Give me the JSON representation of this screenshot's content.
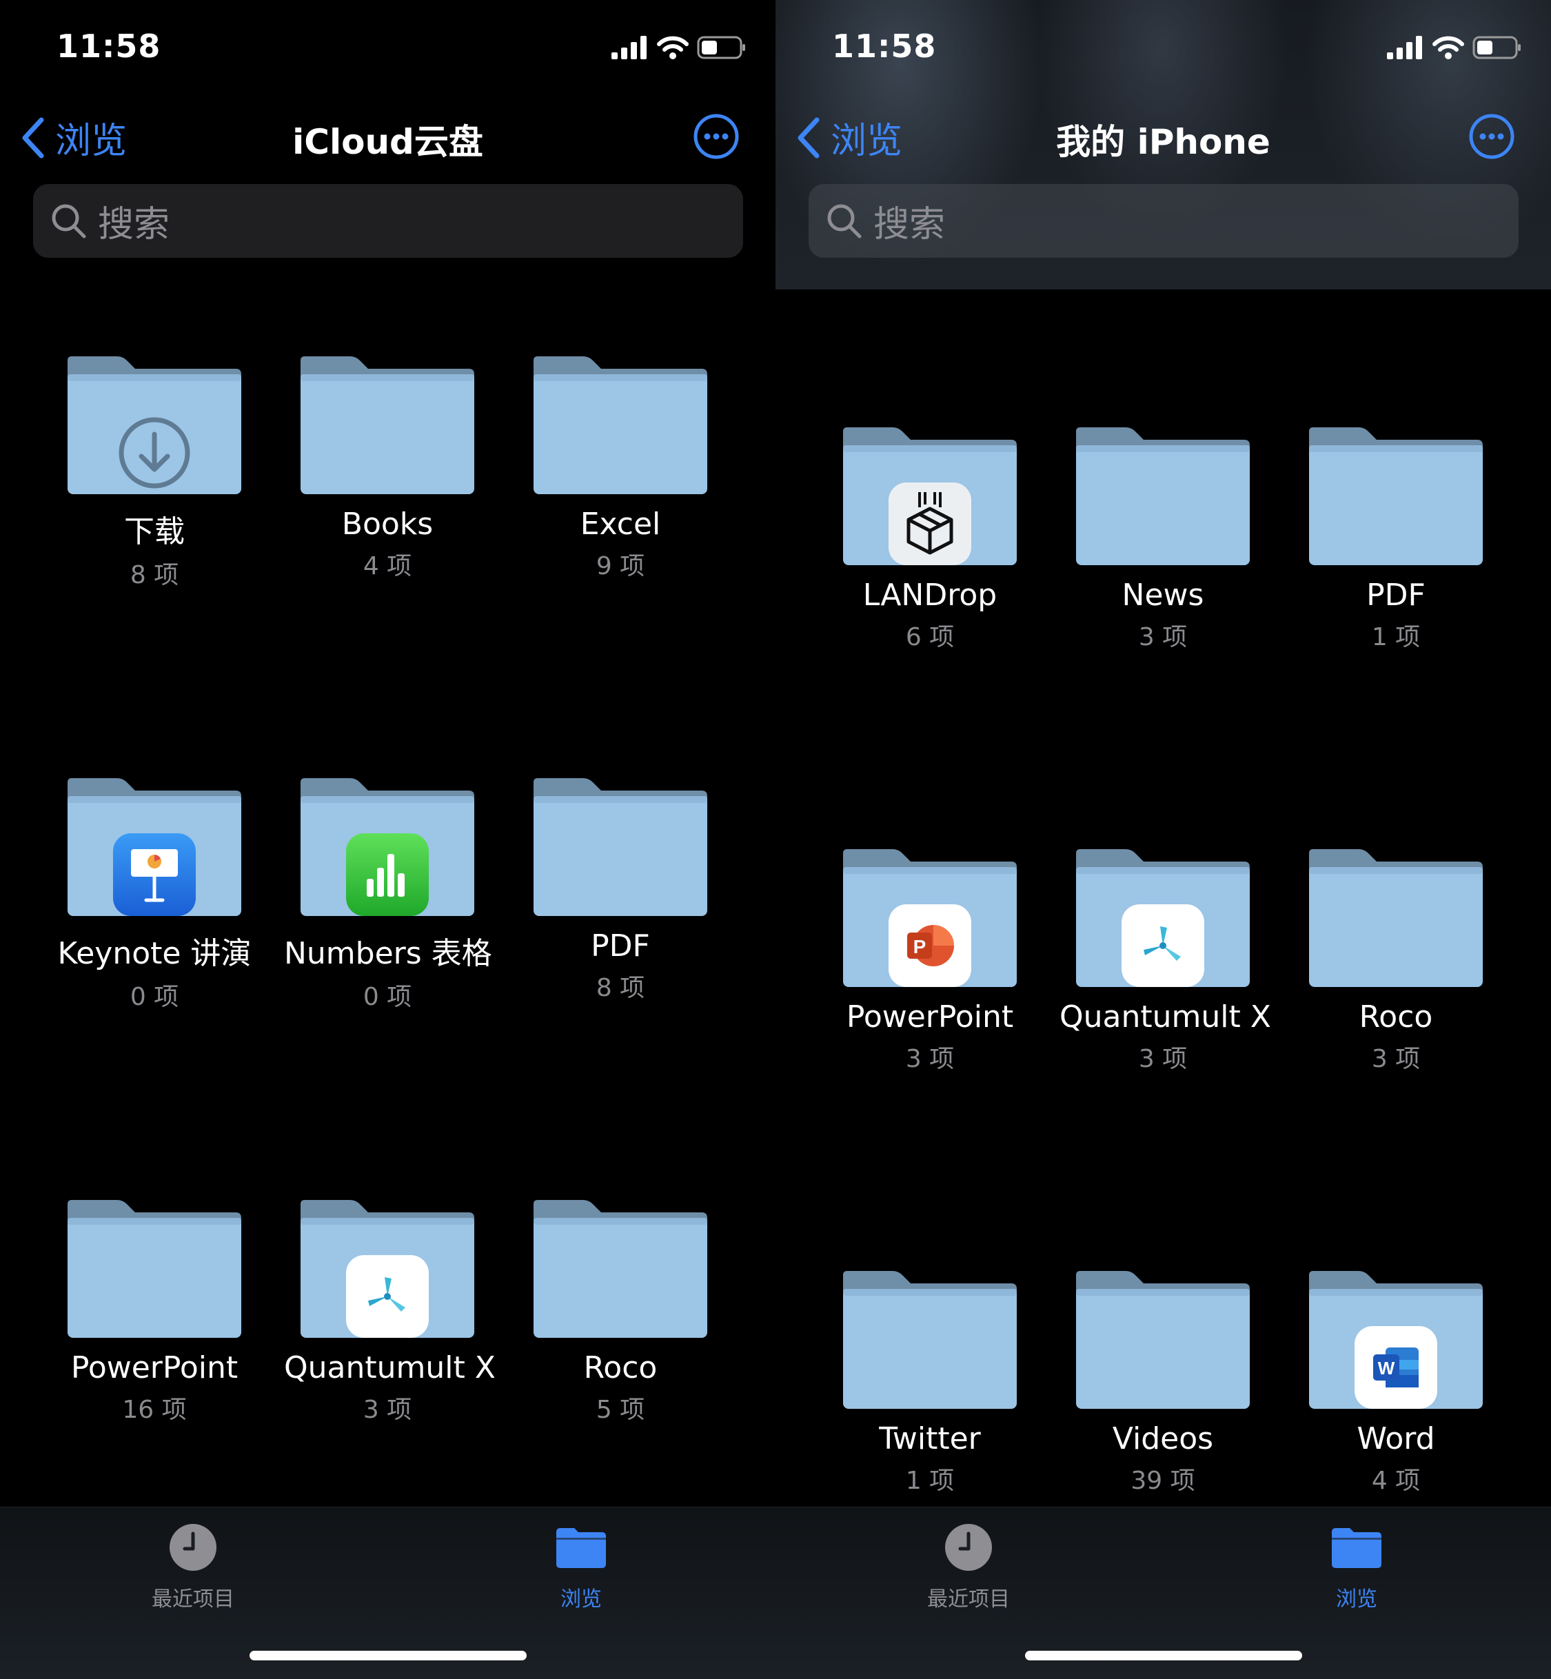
{
  "status_bar": {
    "time": "11:58"
  },
  "colors": {
    "accent": "#3d85f5",
    "folder_body": "#9cc5e6",
    "folder_tab": "#6f8ea8"
  },
  "left": {
    "back_label": "浏览",
    "title": "iCloud云盘",
    "search_placeholder": "搜索",
    "folders": [
      {
        "name": "下载",
        "count": "8 项",
        "icon": "download-arrow-icon"
      },
      {
        "name": "Books",
        "count": "4 项",
        "icon": ""
      },
      {
        "name": "Excel",
        "count": "9 项",
        "icon": ""
      },
      {
        "name": "Keynote 讲演",
        "count": "0 项",
        "icon": "keynote-app-icon"
      },
      {
        "name": "Numbers 表格",
        "count": "0 项",
        "icon": "numbers-app-icon"
      },
      {
        "name": "PDF",
        "count": "8 项",
        "icon": ""
      },
      {
        "name": "PowerPoint",
        "count": "16 项",
        "icon": ""
      },
      {
        "name": "Quantumult X",
        "count": "3 项",
        "icon": "quantumult-x-app-icon"
      },
      {
        "name": "Roco",
        "count": "5 项",
        "icon": ""
      }
    ],
    "tabs": {
      "recents": "最近项目",
      "browse": "浏览"
    }
  },
  "right": {
    "back_label": "浏览",
    "title": "我的 iPhone",
    "search_placeholder": "搜索",
    "folders": [
      {
        "name": "LANDrop",
        "count": "6 项",
        "icon": "landrop-app-icon"
      },
      {
        "name": "News",
        "count": "3 项",
        "icon": ""
      },
      {
        "name": "PDF",
        "count": "1 项",
        "icon": ""
      },
      {
        "name": "PowerPoint",
        "count": "3 项",
        "icon": "powerpoint-app-icon"
      },
      {
        "name": "Quantumult X",
        "count": "3 项",
        "icon": "quantumult-x-app-icon"
      },
      {
        "name": "Roco",
        "count": "3 项",
        "icon": ""
      },
      {
        "name": "Twitter",
        "count": "1 项",
        "icon": ""
      },
      {
        "name": "Videos",
        "count": "39 项",
        "icon": ""
      },
      {
        "name": "Word",
        "count": "4 项",
        "icon": "word-app-icon"
      }
    ],
    "tabs": {
      "recents": "最近项目",
      "browse": "浏览"
    }
  }
}
